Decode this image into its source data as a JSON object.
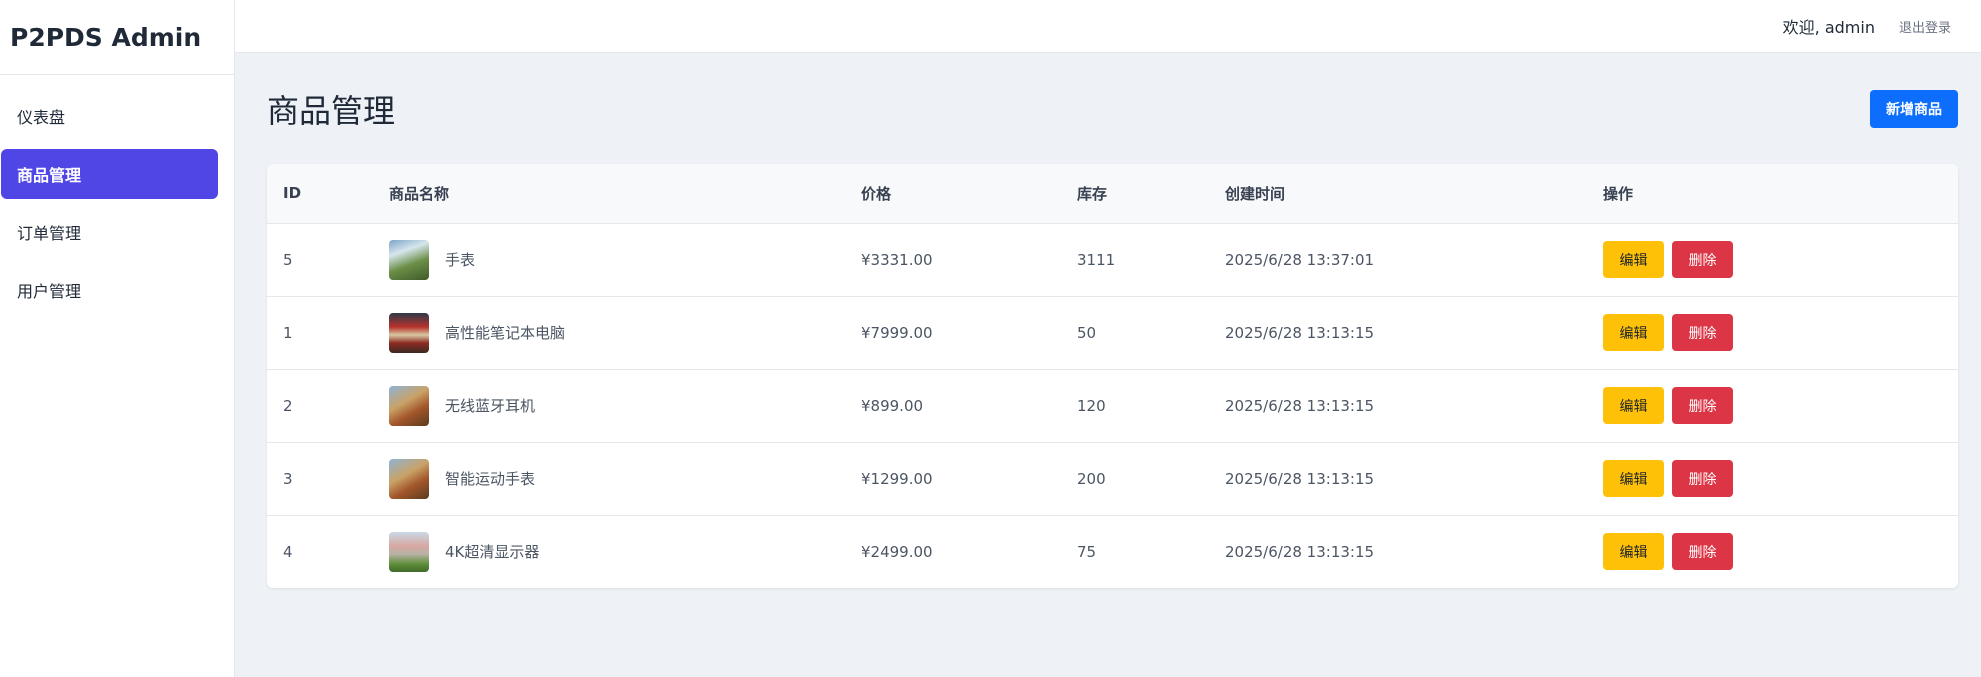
{
  "brand": "P2PDS Admin",
  "nav": [
    {
      "label": "仪表盘",
      "active": false
    },
    {
      "label": "商品管理",
      "active": true
    },
    {
      "label": "订单管理",
      "active": false
    },
    {
      "label": "用户管理",
      "active": false
    }
  ],
  "topbar": {
    "welcome": "欢迎, admin",
    "logout": "退出登录"
  },
  "page": {
    "title": "商品管理",
    "add_button": "新增商品"
  },
  "table": {
    "headers": [
      "ID",
      "商品名称",
      "价格",
      "库存",
      "创建时间",
      "操作"
    ],
    "rows": [
      {
        "id": "5",
        "name": "手表",
        "price": "¥3331.00",
        "stock": "3111",
        "created": "2025/6/28 13:37:01",
        "thumb": "landscape"
      },
      {
        "id": "1",
        "name": "高性能笔记本电脑",
        "price": "¥7999.00",
        "stock": "50",
        "created": "2025/6/28 13:13:15",
        "thumb": "temple"
      },
      {
        "id": "2",
        "name": "无线蓝牙耳机",
        "price": "¥899.00",
        "stock": "120",
        "created": "2025/6/28 13:13:15",
        "thumb": "great-wall"
      },
      {
        "id": "3",
        "name": "智能运动手表",
        "price": "¥1299.00",
        "stock": "200",
        "created": "2025/6/28 13:13:15",
        "thumb": "great-wall"
      },
      {
        "id": "4",
        "name": "4K超清显示器",
        "price": "¥2499.00",
        "stock": "75",
        "created": "2025/6/28 13:13:15",
        "thumb": "city"
      }
    ],
    "edit_label": "编辑",
    "delete_label": "删除"
  },
  "colors": {
    "accent": "#4f46e5",
    "primary": "#0d6efd",
    "warning": "#ffc107",
    "danger": "#dc3545"
  }
}
